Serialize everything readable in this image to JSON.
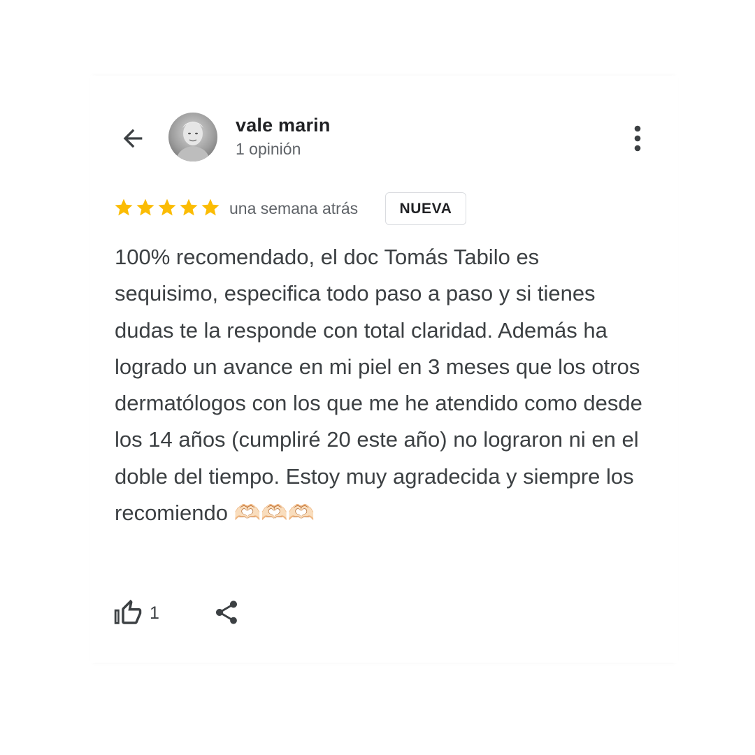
{
  "header": {
    "back_icon": "arrow-left-icon",
    "reviewer_name": "vale marin",
    "review_count": "1 opinión",
    "more_icon": "more-vertical-icon"
  },
  "review": {
    "rating": 5,
    "max_rating": 5,
    "star_color": "#fbbc04",
    "time": "una semana atrás",
    "badge": "NUEVA",
    "text": "100% recomendado, el doc Tomás Tabilo es sequisimo, especifica todo paso a paso y si tienes dudas te la responde con total claridad. Además ha logrado un avance en mi piel en 3 meses que los otros dermatólogos con los que me he atendido como desde los 14 años (cumpliré 20 este año) no lograron ni en el doble del tiempo. Estoy muy agradecida y siempre los recomiendo 🫶🏻🫶🏻🫶🏻"
  },
  "actions": {
    "like_icon": "thumb-up-icon",
    "like_count": "1",
    "share_icon": "share-icon"
  }
}
